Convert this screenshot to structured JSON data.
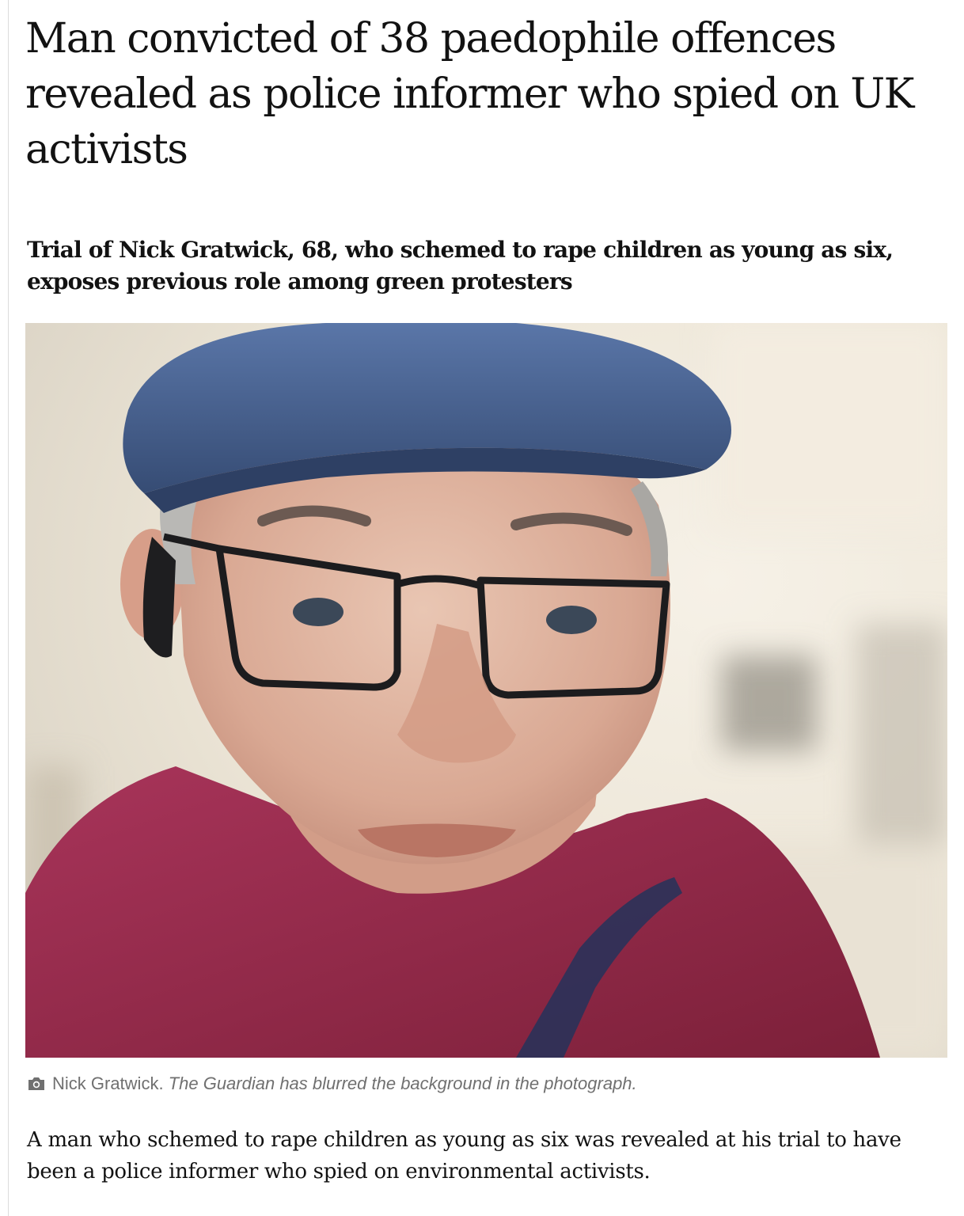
{
  "article": {
    "headline": "Man convicted of 38 paedophile offences revealed as police informer who spied on UK activists",
    "standfirst": "Trial of Nick Gratwick, 68, who schemed to rape children as young as six, exposes previous role among green protesters",
    "image": {
      "subject": "Nick Gratwick"
    },
    "caption": {
      "icon": "camera-icon",
      "name": "Nick Gratwick.",
      "note": "The Guardian has blurred the background in the photograph."
    },
    "body_paragraph": "A man who schemed to rape children as young as six was revealed at his trial to have been a police informer who spied on environmental activists."
  },
  "colors": {
    "text": "#121212",
    "caption": "#707070",
    "cap": "#41587f",
    "jumper": "#8e2a46"
  }
}
